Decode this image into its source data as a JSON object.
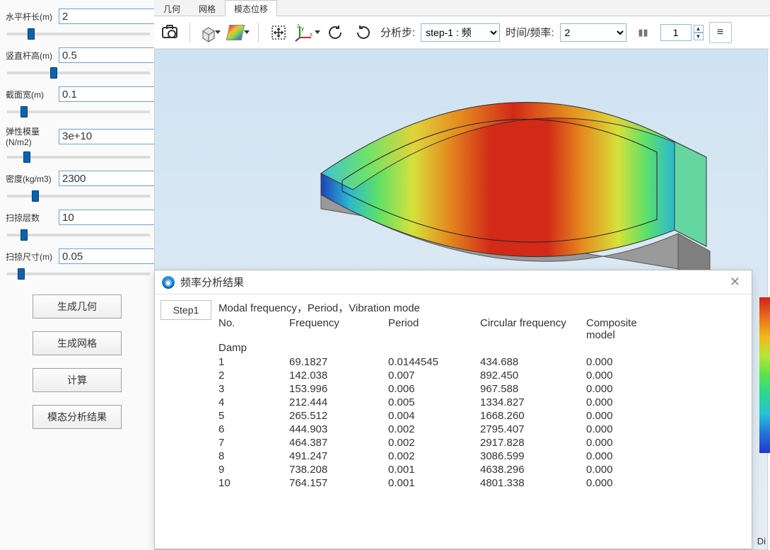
{
  "sidebar": {
    "params": [
      {
        "label": "水平杆长(m)",
        "value": "2",
        "slider": 15
      },
      {
        "label": "竖直杆高(m)",
        "value": "0.5",
        "slider": 32
      },
      {
        "label": "截面宽(m)",
        "value": "0.1",
        "slider": 10
      },
      {
        "label": "弹性模量(N/m2)",
        "value": "3e+10",
        "slider": 12
      },
      {
        "label": "密度(kg/m3)",
        "value": "2300",
        "slider": 18
      },
      {
        "label": "扫掠层数",
        "value": "10",
        "slider": 10
      },
      {
        "label": "扫掠尺寸(m)",
        "value": "0.05",
        "slider": 8
      }
    ],
    "buttons": {
      "gen_geom": "生成几何",
      "gen_mesh": "生成网格",
      "calc": "计算",
      "modal": "模态分析结果"
    }
  },
  "tabs": {
    "geom": "几何",
    "mesh": "网格",
    "disp": "模态位移"
  },
  "toolbar": {
    "analysis_step_label": "分析步:",
    "step_select": "step-1 : 频",
    "time_freq_label": "时间/频率:",
    "time_freq_value": "2",
    "stepper_value": "1"
  },
  "viewport": {
    "corner_label": "Di"
  },
  "dialog": {
    "title": "频率分析结果",
    "tab_label": "Step1",
    "header1": "Modal frequency，Period，Vibration mode",
    "col_no": "No.",
    "col_freq": "Frequency",
    "col_period": "Period",
    "col_circ": "Circular frequency",
    "col_damp_model": "Composite model",
    "damp_label": "Damp",
    "rows": [
      {
        "n": "1",
        "f": "69.1827",
        "p": "0.0144545",
        "cf": "434.688",
        "d": "0.000"
      },
      {
        "n": "2",
        "f": "142.038",
        "p": "0.007",
        "cf": "892.450",
        "d": "0.000"
      },
      {
        "n": "3",
        "f": "153.996",
        "p": "0.006",
        "cf": "967.588",
        "d": "0.000"
      },
      {
        "n": "4",
        "f": "212.444",
        "p": "0.005",
        "cf": "1334.827",
        "d": "0.000"
      },
      {
        "n": "5",
        "f": "265.512",
        "p": "0.004",
        "cf": "1668.260",
        "d": "0.000"
      },
      {
        "n": "6",
        "f": "444.903",
        "p": "0.002",
        "cf": "2795.407",
        "d": "0.000"
      },
      {
        "n": "7",
        "f": "464.387",
        "p": "0.002",
        "cf": "2917.828",
        "d": "0.000"
      },
      {
        "n": "8",
        "f": "491.247",
        "p": "0.002",
        "cf": "3086.599",
        "d": "0.000"
      },
      {
        "n": "9",
        "f": "738.208",
        "p": "0.001",
        "cf": "4638.296",
        "d": "0.000"
      },
      {
        "n": "10",
        "f": "764.157",
        "p": "0.001",
        "cf": "4801.338",
        "d": "0.000"
      }
    ]
  }
}
